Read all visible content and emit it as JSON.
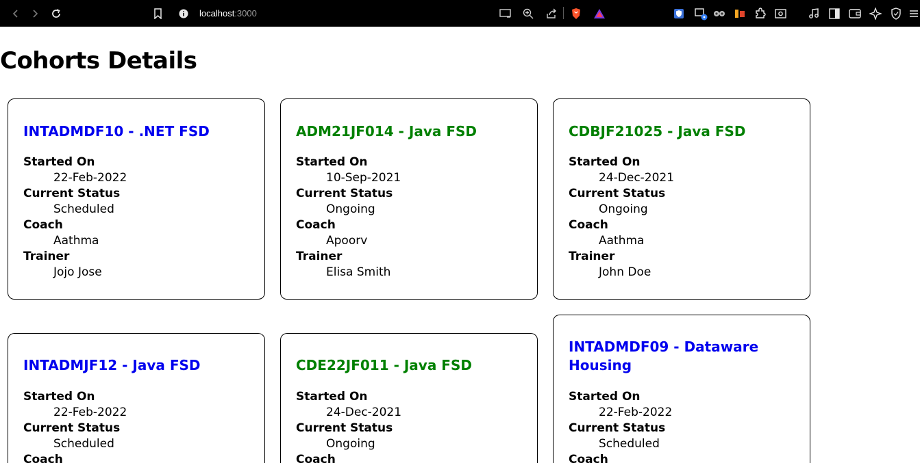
{
  "browser": {
    "url_host": "localhost",
    "url_port": ":3000"
  },
  "page": {
    "title": "Cohorts Details"
  },
  "labels": {
    "started_on": "Started On",
    "current_status": "Current Status",
    "coach": "Coach",
    "trainer": "Trainer"
  },
  "cohorts": [
    {
      "title": "INTADMDF10 - .NET FSD",
      "title_color": "#0000ee",
      "started_on": "22-Feb-2022",
      "status": "Scheduled",
      "coach": "Aathma",
      "trainer": "Jojo Jose"
    },
    {
      "title": "ADM21JF014 - Java FSD",
      "title_color": "#008000",
      "started_on": "10-Sep-2021",
      "status": "Ongoing",
      "coach": "Apoorv",
      "trainer": "Elisa Smith"
    },
    {
      "title": "CDBJF21025 - Java FSD",
      "title_color": "#008000",
      "started_on": "24-Dec-2021",
      "status": "Ongoing",
      "coach": "Aathma",
      "trainer": "John Doe"
    },
    {
      "title": "INTADMJF12 - Java FSD",
      "title_color": "#0000ee",
      "started_on": "22-Feb-2022",
      "status": "Scheduled"
    },
    {
      "title": "CDE22JF011 - Java FSD",
      "title_color": "#008000",
      "started_on": "24-Dec-2021",
      "status": "Ongoing"
    },
    {
      "title": "INTADMDF09 - Dataware Housing",
      "title_color": "#0000ee",
      "started_on": "22-Feb-2022",
      "status": "Scheduled"
    }
  ]
}
